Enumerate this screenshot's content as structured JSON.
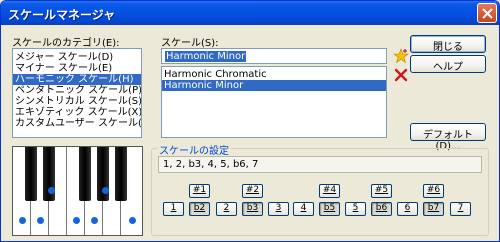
{
  "window": {
    "title": "スケールマネージャ"
  },
  "categories": {
    "label": "スケールのカテゴリ(E):",
    "items": [
      {
        "label": "メジャー スケール(D)",
        "selected": false
      },
      {
        "label": "マイナー スケール(E)",
        "selected": false
      },
      {
        "label": "ハーモニック スケール(H)",
        "selected": true
      },
      {
        "label": "ペンタトニック スケール(P)",
        "selected": false
      },
      {
        "label": "シンメトリカル スケール(S)",
        "selected": false
      },
      {
        "label": "エキゾティック スケール(X)",
        "selected": false
      },
      {
        "label": "カスタムユーザー スケール(U)",
        "selected": false
      }
    ]
  },
  "scales": {
    "label": "スケール(S):",
    "current_value": "Harmonic Minor",
    "items": [
      {
        "label": "Harmonic Chromatic",
        "selected": false
      },
      {
        "label": "Harmonic Minor",
        "selected": true
      }
    ]
  },
  "buttons": {
    "close": "閉じる",
    "help": "ヘルプ",
    "default": "デフォルト(D)..."
  },
  "settings": {
    "group_label": "スケールの設定",
    "formula": "1, 2, b3, 4, 5, b6, 7",
    "sharps": [
      "#1",
      "#2",
      "#4",
      "#5",
      "#6"
    ],
    "degrees": [
      {
        "label": "1",
        "on": false
      },
      {
        "label": "b2",
        "on": true
      },
      {
        "label": "2",
        "on": false
      },
      {
        "label": "b3",
        "on": true
      },
      {
        "label": "3",
        "on": false
      },
      {
        "label": "4",
        "on": false
      },
      {
        "label": "b5",
        "on": true
      },
      {
        "label": "5",
        "on": false
      },
      {
        "label": "b6",
        "on": true
      },
      {
        "label": "6",
        "on": false
      },
      {
        "label": "b7",
        "on": true
      },
      {
        "label": "7",
        "on": false
      }
    ]
  },
  "colors": {
    "title_bar": "#0550e0",
    "selection": "#316ac5",
    "piano_dot": "#1565d8"
  },
  "icons": {
    "add": "star-add-icon",
    "delete": "red-x-icon",
    "close": "close-icon"
  }
}
